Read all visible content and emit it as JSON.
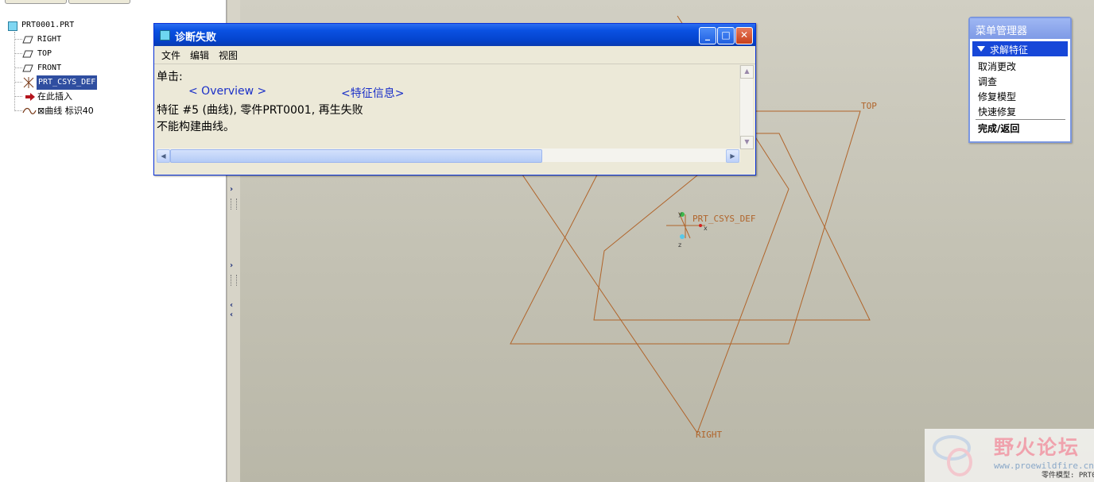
{
  "model_tree": {
    "root": "PRT0001.PRT",
    "items": [
      {
        "label": "RIGHT",
        "icon": "datum-plane-icon"
      },
      {
        "label": "TOP",
        "icon": "datum-plane-icon"
      },
      {
        "label": "FRONT",
        "icon": "datum-plane-icon"
      },
      {
        "label": "PRT_CSYS_DEF",
        "icon": "csys-icon",
        "selected": true
      },
      {
        "label": "在此插入",
        "icon": "insert-arrow-icon"
      },
      {
        "label": "⊠曲线 标识40",
        "icon": "curve-icon"
      }
    ]
  },
  "graphics": {
    "datum_labels": {
      "top": "TOP",
      "right": "RIGHT",
      "csys": "PRT_CSYS_DEF"
    },
    "axis_labels": {
      "x": "x",
      "y": "y",
      "z": "z"
    },
    "datum_color": "#b0642a",
    "status_text": "零件模型: PRT0"
  },
  "dialog": {
    "title": "诊断失败",
    "menu": [
      "文件",
      "编辑",
      "视图"
    ],
    "lines": {
      "click_label": "单击:",
      "link_overview": "< Overview >",
      "link_feature_info": "<特征信息>",
      "message1": "特征 #5 (曲线), 零件PRT0001,  再生失败",
      "message2": "不能构建曲线。"
    },
    "window_buttons": {
      "minimize": "_",
      "maximize": "□",
      "close": "✕"
    }
  },
  "menu_manager": {
    "title": "菜单管理器",
    "header": "求解特征",
    "items": [
      "取消更改",
      "调查",
      "修复模型",
      "快速修复"
    ],
    "done": "完成/返回",
    "accent_color": "#1747d8"
  },
  "watermark": {
    "title": "野火论坛",
    "url": "www.proewildfire.cn"
  }
}
